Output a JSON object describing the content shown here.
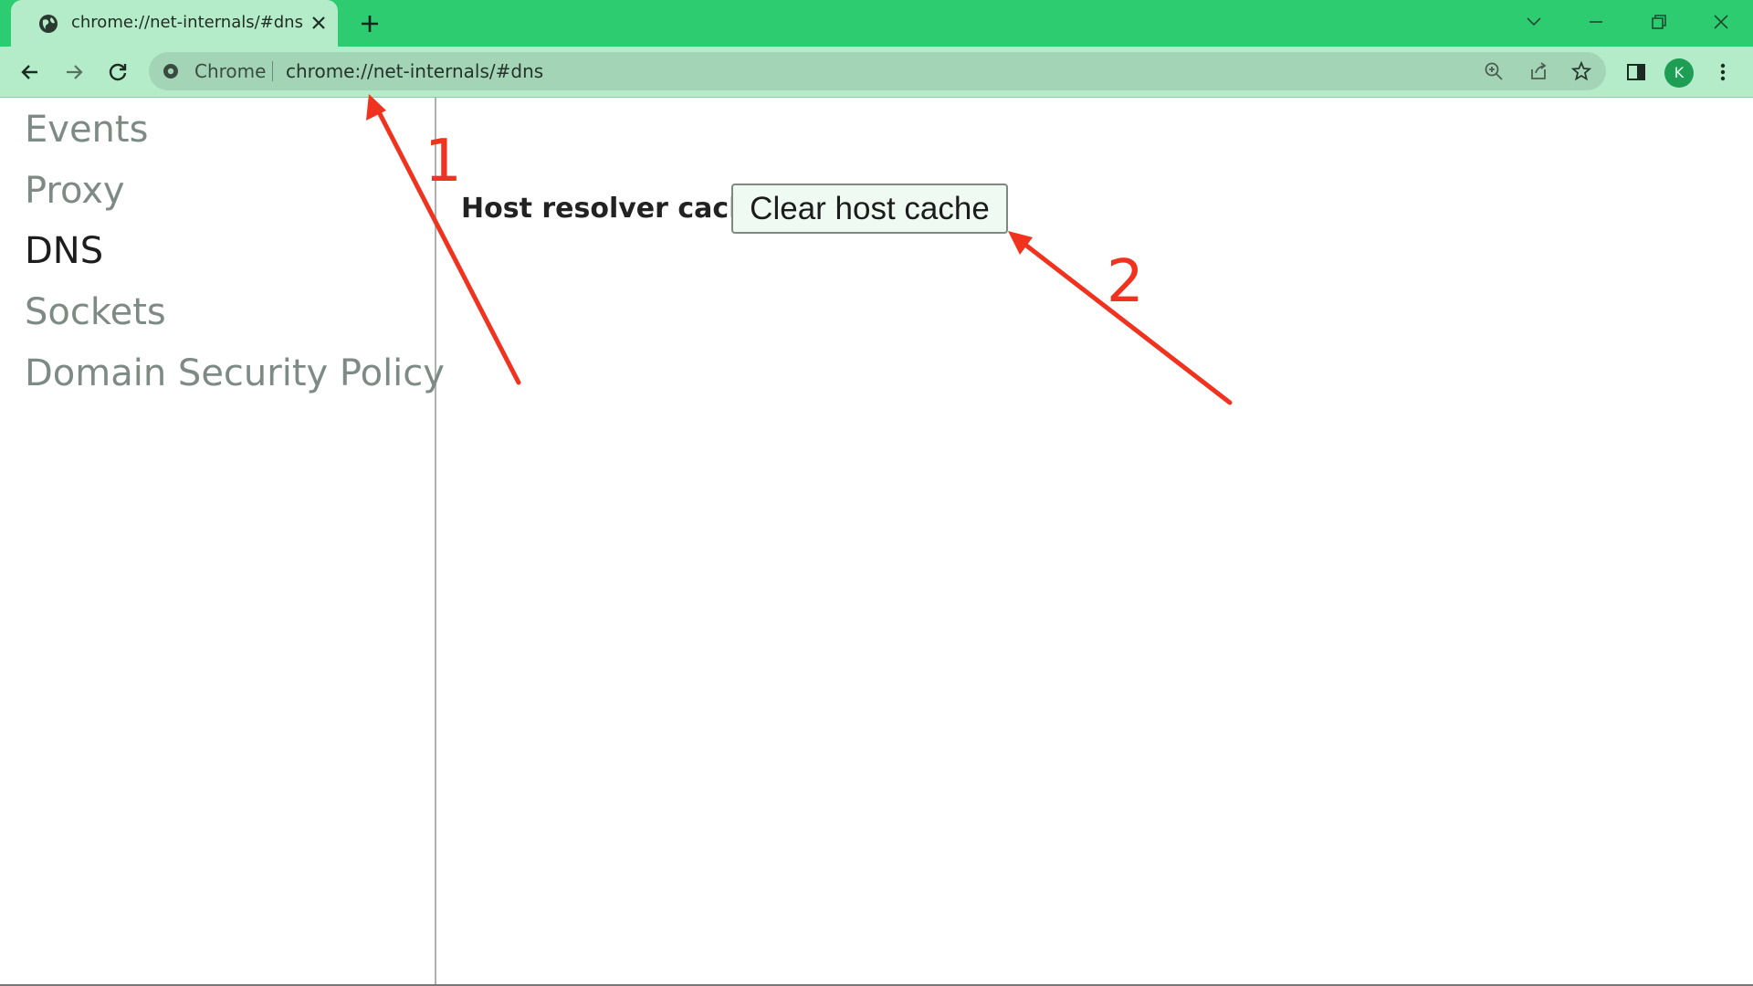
{
  "browser": {
    "tab": {
      "title": "chrome://net-internals/#dns"
    },
    "omnibox": {
      "chip": "Chrome",
      "url": "chrome://net-internals/#dns"
    },
    "profile_initial": "K",
    "icons": [
      "globe-icon",
      "close-icon",
      "plus-icon",
      "chevron-down-icon",
      "minimize-icon",
      "restore-icon",
      "window-close-icon",
      "back-icon",
      "forward-icon",
      "reload-icon",
      "info-icon",
      "zoom-icon",
      "share-icon",
      "star-icon",
      "side-panel-icon",
      "more-icon"
    ]
  },
  "sidebar": {
    "items": [
      {
        "label": "Events",
        "active": false
      },
      {
        "label": "Proxy",
        "active": false
      },
      {
        "label": "DNS",
        "active": true
      },
      {
        "label": "Sockets",
        "active": false
      },
      {
        "label": "Domain Security Policy",
        "active": false
      }
    ]
  },
  "main": {
    "label": "Host resolver cache",
    "button": "Clear host cache"
  },
  "annotations": {
    "one": "1",
    "two": "2",
    "color": "#f0321e"
  },
  "colors": {
    "tabstrip": "#2ecc71",
    "toolbar": "#b4ecc9",
    "omnibox": "#a3d4b6"
  }
}
